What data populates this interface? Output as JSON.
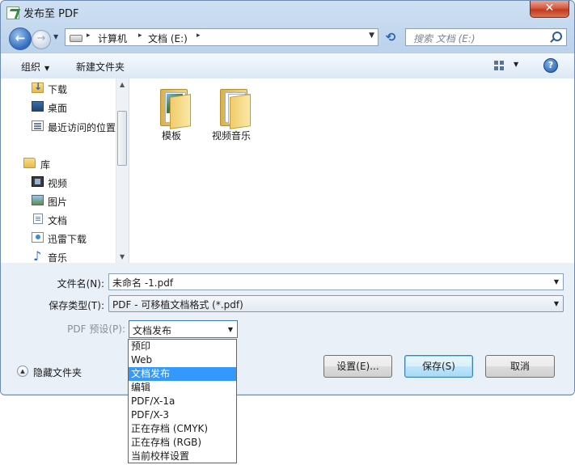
{
  "window": {
    "title": "发布至 PDF",
    "close_glyph": "✕"
  },
  "address_bar": {
    "back_glyph": "←",
    "forward_glyph": "→",
    "crumbs": [
      "计算机",
      "文档 (E:)"
    ],
    "separator": "▸",
    "search_placeholder": "搜索 文档 (E:)"
  },
  "toolbar": {
    "organize": "组织",
    "new_folder": "新建文件夹",
    "help_glyph": "?"
  },
  "nav_pane": {
    "items": [
      {
        "label": "下载",
        "icon": "download-folder-icon"
      },
      {
        "label": "桌面",
        "icon": "desktop-icon"
      },
      {
        "label": "最近访问的位置",
        "icon": "recent-places-icon"
      },
      {
        "label": "库",
        "icon": "library-icon"
      },
      {
        "label": "视频",
        "icon": "video-library-icon"
      },
      {
        "label": "图片",
        "icon": "pictures-library-icon"
      },
      {
        "label": "文档",
        "icon": "documents-library-icon"
      },
      {
        "label": "迅雷下载",
        "icon": "thunder-download-icon"
      },
      {
        "label": "音乐",
        "icon": "music-library-icon"
      }
    ]
  },
  "content": {
    "files": [
      {
        "name": "模板",
        "icon": "folder-icon"
      },
      {
        "name": "视频音乐",
        "icon": "folder-icon"
      }
    ]
  },
  "form": {
    "filename_label": "文件名(N):",
    "filename_value": "未命名 -1.pdf",
    "filetype_label": "保存类型(T):",
    "filetype_value": "PDF - 可移植文档格式 (*.pdf)",
    "preset_label": "PDF 预设(P):",
    "preset_value": "文档发布",
    "hide_folders": "隐藏文件夹",
    "settings_button": "设置(E)...",
    "save_button": "保存(S)",
    "cancel_button": "取消"
  },
  "preset_dropdown": {
    "options": [
      "预印",
      "Web",
      "文档发布",
      "编辑",
      "PDF/X-1a",
      "PDF/X-3",
      "正在存档 (CMYK)",
      "正在存档 (RGB)",
      "当前校样设置"
    ],
    "selected": "文档发布"
  },
  "colors": {
    "selection": "#3399ff",
    "close_button": "#c3391f",
    "frame": "#bcd3ec"
  }
}
